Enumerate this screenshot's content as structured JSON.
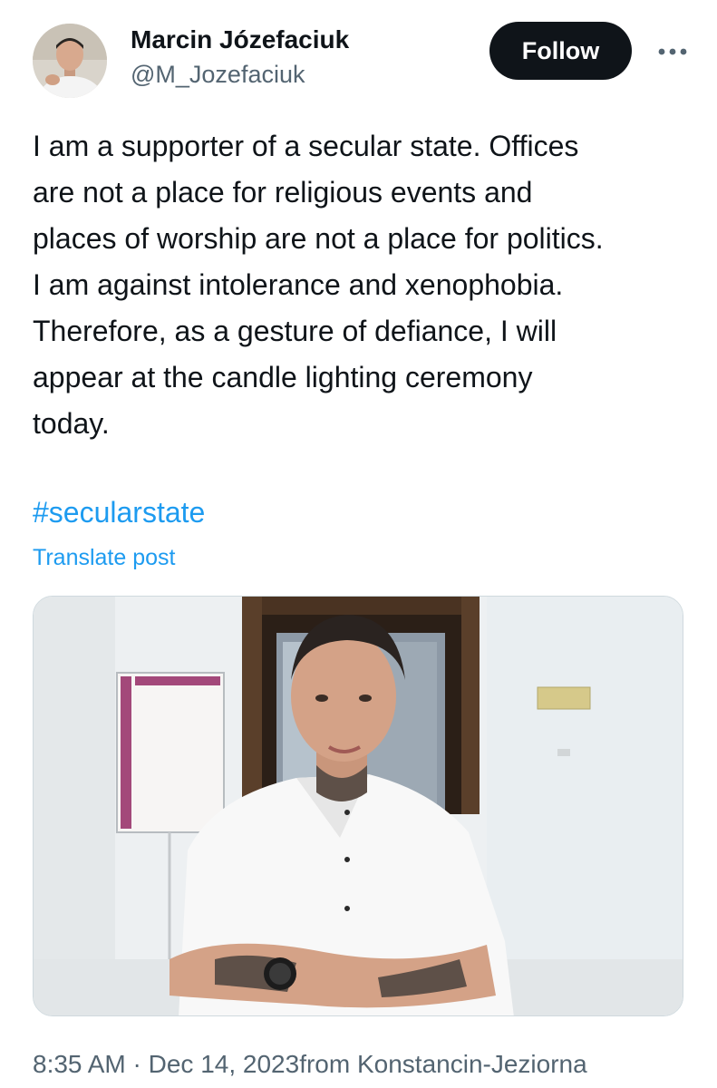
{
  "author": {
    "display_name": "Marcin Józefaciuk",
    "handle": "@M_Jozefaciuk"
  },
  "actions": {
    "follow_label": "Follow",
    "more_icon": "more-horizontal-icon"
  },
  "post": {
    "text": "I am a supporter of a secular state. Offices\nare not a place for religious events and\nplaces of worship are not a place for politics.\nI am against intolerance and xenophobia.\nTherefore, as a gesture of defiance, I will\nappear at the candle lighting ceremony\ntoday.",
    "hashtag": "#secularstate",
    "translate_label": "Translate post"
  },
  "meta": {
    "time": "8:35 AM",
    "separator": " · ",
    "date": "Dec 14, 2023",
    "location": "from Konstancin-Jeziorna"
  },
  "colors": {
    "text": "#0f1419",
    "secondary": "#536471",
    "link": "#1d9bf0",
    "follow_bg": "#0f1419",
    "border": "#cfd9de"
  }
}
